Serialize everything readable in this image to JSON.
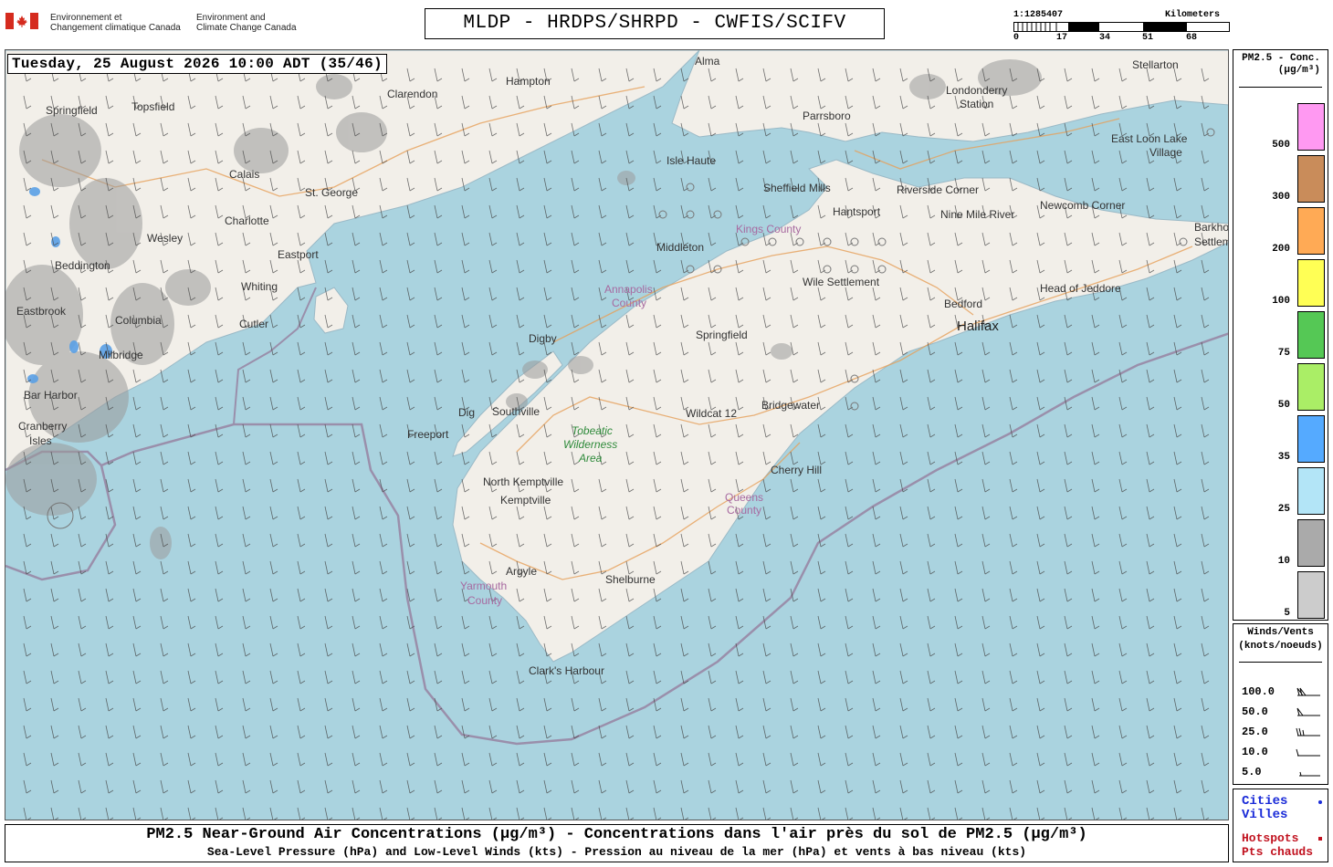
{
  "header": {
    "agency_fr": [
      "Environnement et",
      "Changement climatique Canada"
    ],
    "agency_en": [
      "Environment and",
      "Climate Change Canada"
    ],
    "title": "MLDP - HRDPS/SHRPD - CWFIS/SCIFV",
    "scale_ratio": "1:1285407",
    "scale_unit": "Kilometers",
    "scale_ticks": [
      "0",
      "17",
      "34",
      "51",
      "68"
    ]
  },
  "map": {
    "timestamp": "Tuesday, 25 August 2026 10:00 ADT (35/46)",
    "places": [
      {
        "name": "Alma"
      },
      {
        "name": "Hampton"
      },
      {
        "name": "Clarendon"
      },
      {
        "name": "Topsfield"
      },
      {
        "name": "Springfield"
      },
      {
        "name": "Calais"
      },
      {
        "name": "St. George"
      },
      {
        "name": "Charlotte"
      },
      {
        "name": "Wesley"
      },
      {
        "name": "Eastport"
      },
      {
        "name": "Beddington"
      },
      {
        "name": "Whiting"
      },
      {
        "name": "Cutler"
      },
      {
        "name": "Columbia"
      },
      {
        "name": "Eastbrook"
      },
      {
        "name": "Milbridge"
      },
      {
        "name": "Bar Harbor"
      },
      {
        "name": "Cranberry Isles"
      },
      {
        "name": "Isle Haute"
      },
      {
        "name": "Parrsboro"
      },
      {
        "name": "Sheffield Mills"
      },
      {
        "name": "Hantsport"
      },
      {
        "name": "Riverside Corner"
      },
      {
        "name": "Nine Mile River"
      },
      {
        "name": "Middleton"
      },
      {
        "name": "Wile Settlement"
      },
      {
        "name": "Bedford"
      },
      {
        "name": "Halifax"
      },
      {
        "name": "Head of Jeddore"
      },
      {
        "name": "Newcomb Corner"
      },
      {
        "name": "Barkhouse Settlement"
      },
      {
        "name": "East Loon Lake Village"
      },
      {
        "name": "Londonderry Station"
      },
      {
        "name": "Stellarton"
      },
      {
        "name": "Digby"
      },
      {
        "name": "Springfield"
      },
      {
        "name": "Southville"
      },
      {
        "name": "Freeport"
      },
      {
        "name": "Wildcat 12"
      },
      {
        "name": "Bridgewater"
      },
      {
        "name": "Cherry Hill"
      },
      {
        "name": "North Kemptville"
      },
      {
        "name": "Kemptville"
      },
      {
        "name": "Argyle"
      },
      {
        "name": "Shelburne"
      },
      {
        "name": "Clark's Harbour"
      }
    ],
    "counties": [
      "Kings County",
      "Annapolis County",
      "Queens County",
      "Yarmouth County"
    ],
    "parks": [
      "Tobeatic Wilderness Area"
    ]
  },
  "legend": {
    "title": [
      "PM2.5 - Conc.",
      "(µg/m³)"
    ],
    "bins": [
      {
        "label": "500",
        "color": "#ff99f2"
      },
      {
        "label": "300",
        "color": "#c98c5a"
      },
      {
        "label": "200",
        "color": "#ffaa55"
      },
      {
        "label": "100",
        "color": "#ffff55"
      },
      {
        "label": "75",
        "color": "#55c855"
      },
      {
        "label": "50",
        "color": "#aaee66"
      },
      {
        "label": "35",
        "color": "#55aaff"
      },
      {
        "label": "25",
        "color": "#b3e5f7"
      },
      {
        "label": "10",
        "color": "#aaaaaa"
      },
      {
        "label": "5",
        "color": "#cccccc"
      }
    ]
  },
  "winds": {
    "title": [
      "Winds/Vents",
      "(knots/noeuds)"
    ],
    "rows": [
      "100.0",
      "50.0",
      "25.0",
      "10.0",
      "5.0"
    ]
  },
  "points": {
    "cities": [
      "Cities",
      "Villes"
    ],
    "hotspots": [
      "Hotspots",
      "Pts chauds"
    ]
  },
  "footer": {
    "line1": "PM2.5 Near-Ground Air Concentrations (µg/m³) - Concentrations dans l'air près du sol de PM2.5 (µg/m³)",
    "line2": "Sea-Level Pressure (hPa) and Low-Level Winds (kts) - Pression au niveau de la mer (hPa) et vents à bas niveau (kts)"
  }
}
